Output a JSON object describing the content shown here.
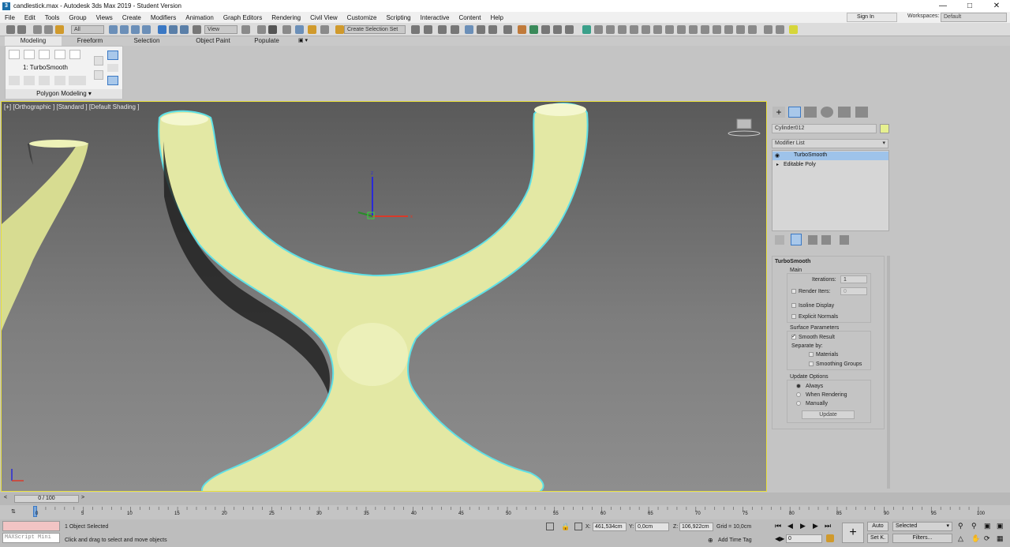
{
  "window": {
    "title": "candlestick.max - Autodesk 3ds Max 2019 - Student Version"
  },
  "menu": [
    "File",
    "Edit",
    "Tools",
    "Group",
    "Views",
    "Create",
    "Modifiers",
    "Animation",
    "Graph Editors",
    "Rendering",
    "Civil View",
    "Customize",
    "Scripting",
    "Interactive",
    "Content",
    "Help"
  ],
  "account": {
    "sign_in": "Sign In",
    "workspaces_label": "Workspaces:",
    "workspace": "Default"
  },
  "toolbar": {
    "selection_filter": "All",
    "ref_coord": "View",
    "named_selection": "Create Selection Set"
  },
  "ribbon": {
    "tabs": [
      "Modeling",
      "Freeform",
      "Selection",
      "Object Paint",
      "Populate"
    ],
    "modifier_label": "1: TurboSmooth",
    "panel_label": "Polygon Modeling"
  },
  "viewport": {
    "label": "[+] [Orthographic ] [Standard ] [Default Shading ]"
  },
  "command_panel": {
    "object_name": "Cylinder012",
    "object_color": "#e6f08f",
    "modifier_list": "Modifier List",
    "stack": [
      "TurboSmooth",
      "Editable Poly"
    ],
    "rollout_title": "TurboSmooth",
    "main_label": "Main",
    "iterations_label": "Iterations:",
    "iterations_value": "1",
    "render_iters_label": "Render Iters:",
    "render_iters_value": "0",
    "isoline_display": "Isoline Display",
    "explicit_normals": "Explicit Normals",
    "surface_params": "Surface Parameters",
    "smooth_result": "Smooth Result",
    "separate_by": "Separate by:",
    "materials": "Materials",
    "smoothing_groups": "Smoothing Groups",
    "update_options": "Update Options",
    "always": "Always",
    "when_rendering": "When Rendering",
    "manually": "Manually",
    "update_button": "Update"
  },
  "timeline": {
    "frame": "0 / 100",
    "ticks": [
      "0",
      "5",
      "10",
      "15",
      "20",
      "25",
      "30",
      "35",
      "40",
      "45",
      "50",
      "55",
      "60",
      "65",
      "70",
      "75",
      "80",
      "85",
      "90",
      "95",
      "100"
    ]
  },
  "status": {
    "maxscript": "MAXScript Mini",
    "selected": "1 Object Selected",
    "prompt": "Click and drag to select and move objects",
    "x_label": "X:",
    "x": "461,534cm",
    "y_label": "Y:",
    "y": "0,0cm",
    "z_label": "Z:",
    "z": "106,922cm",
    "grid": "Grid = 10,0cm",
    "add_time_tag": "Add Time Tag",
    "auto": "Auto",
    "set_key": "Set K.",
    "key_filter": "Selected",
    "filters": "Filters...",
    "current_frame": "0"
  },
  "colors": {
    "selection_outline": "#5fe0e6",
    "viewport_border": "#e8df3a",
    "mesh": "#e3e8a4"
  }
}
